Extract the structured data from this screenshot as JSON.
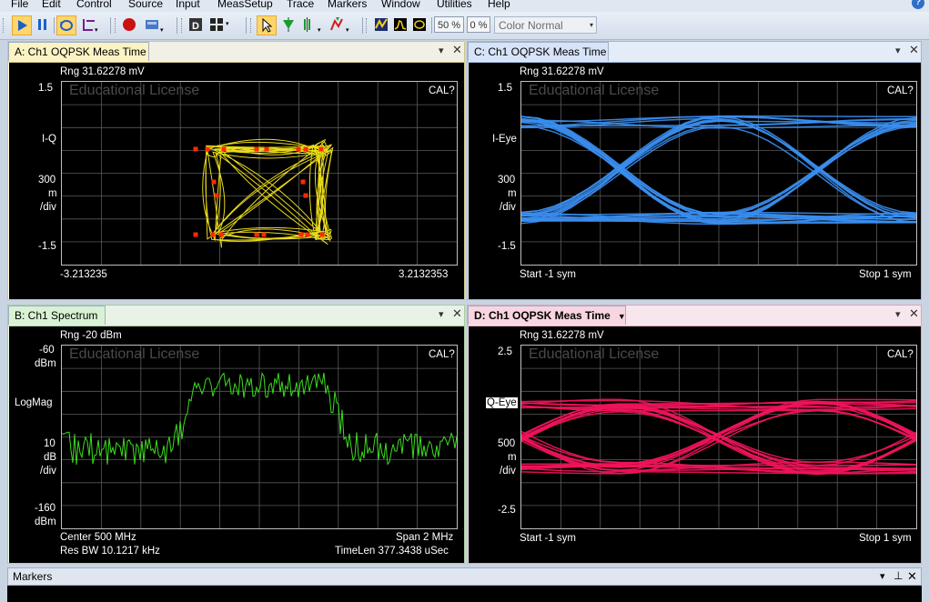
{
  "menu": [
    "File",
    "Edit",
    "Control",
    "Source",
    "Input",
    "MeasSetup",
    "Trace",
    "Markers",
    "Window",
    "Utilities",
    "Help"
  ],
  "toolbar": {
    "zoom_pct": "50 %",
    "overlap_pct": "0 %",
    "color_scheme": "Color Normal",
    "icons": [
      "play-icon",
      "pause-icon",
      "restart-icon",
      "preset-icon",
      "record-icon",
      "playback-icon",
      "data-icon",
      "display-layout-icon",
      "pointer-icon",
      "marker-icon",
      "marker-peak-icon",
      "marker-search-icon",
      "trace-icon",
      "spectrum-view-icon",
      "meas-view-icon",
      "capture-icon"
    ]
  },
  "panels": {
    "a": {
      "title": "A: Ch1 OQPSK Meas Time",
      "rng": "Rng 31.62278 mV",
      "license": "Educational License",
      "cal": "CAL?",
      "y_top": "1.5",
      "y_label": "I-Q",
      "scale_val": "300",
      "scale_unit": "m",
      "scale_div": "/div",
      "y_bot": "-1.5",
      "x_left": "-3.213235",
      "x_right": "3.2132353",
      "trace_color": "#f5e61a",
      "marker_color": "#ff2a00"
    },
    "b": {
      "title": "B: Ch1 Spectrum",
      "rng": "Rng -20 dBm",
      "license": "Educational License",
      "cal": "CAL?",
      "y_top": "-60",
      "y_top_unit": "dBm",
      "y_label": "LogMag",
      "scale_val": "10",
      "scale_unit": "dB",
      "scale_div": "/div",
      "y_bot": "-160",
      "y_bot_unit": "dBm",
      "center": "Center 500 MHz",
      "span": "Span 2 MHz",
      "res_bw": "Res BW 10.1217 kHz",
      "timelen": "TimeLen 377.3438 uSec",
      "trace_color": "#3cdc1e"
    },
    "c": {
      "title": "C: Ch1 OQPSK Meas Time",
      "rng": "Rng 31.62278 mV",
      "license": "Educational License",
      "cal": "CAL?",
      "y_top": "1.5",
      "y_label": "I-Eye",
      "scale_val": "300",
      "scale_unit": "m",
      "scale_div": "/div",
      "y_bot": "-1.5",
      "x_left": "Start -1  sym",
      "x_right": "Stop 1  sym",
      "trace_color": "#3a8ef0"
    },
    "d": {
      "title": "D: Ch1 OQPSK Meas Time",
      "rng": "Rng 31.62278 mV",
      "license": "Educational License",
      "cal": "CAL?",
      "y_top": "2.5",
      "y_label": "Q-Eye",
      "scale_val": "500",
      "scale_unit": "m",
      "scale_div": "/div",
      "y_bot": "-2.5",
      "x_left": "Start -1  sym",
      "x_right": "Stop 1  sym",
      "trace_color": "#f0145a"
    }
  },
  "markers_panel": {
    "title": "Markers"
  },
  "colors": {
    "tab_a": "#fbf3c3",
    "tab_b": "#d9f2d3",
    "tab_c": "#d7e3f8",
    "tab_d": "#f9d5df"
  }
}
